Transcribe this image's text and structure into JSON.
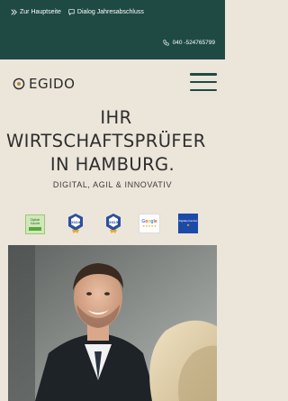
{
  "topbar": {
    "links": [
      {
        "label": "Zur Hauptseite",
        "icon": "double-chevron-right-icon"
      },
      {
        "label": "Dialog Jahresabschluss",
        "icon": "chat-bubble-icon"
      }
    ],
    "phone": "040 -524765799",
    "phone_icon": "phone-icon",
    "background": "#1f4a44"
  },
  "header": {
    "logo_text": "EGIDO",
    "menu_icon": "hamburger-menu-icon"
  },
  "hero": {
    "line1": "IHR",
    "line2": "WIRTSCHAFTSPRÜFER",
    "line3": "IN HAMBURG.",
    "subline": "DIGITAL, AGIL & INNOVATIV"
  },
  "badges": {
    "badge1_text": "Digitale Kanzlei",
    "badge2_year": "2024",
    "badge3_year": "2023",
    "badge4_label": "Google",
    "badge4_stars": "★★★★★",
    "badge5_text": "Digitale Kanzlei",
    "badge5_star": "★"
  },
  "colors": {
    "accent": "#1f4a44",
    "page_background": "#ece5da"
  }
}
